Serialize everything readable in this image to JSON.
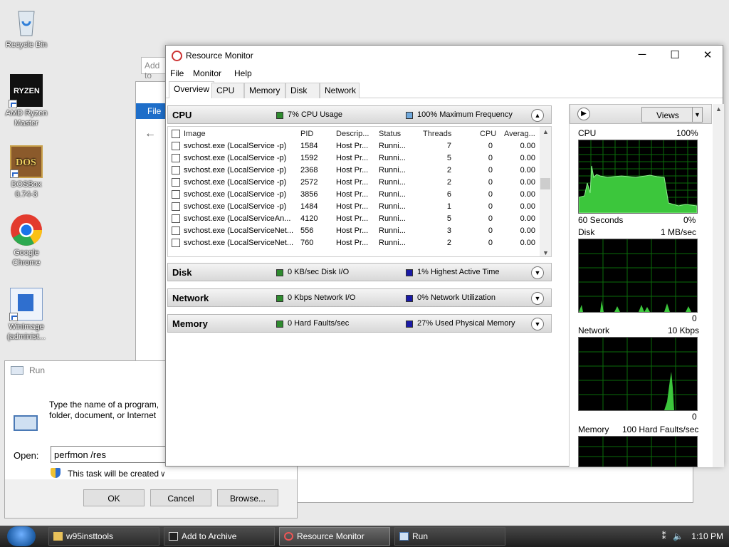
{
  "desktop": {
    "icons": [
      {
        "label": "Recycle Bin"
      },
      {
        "label": "AMD Ryzen Master"
      },
      {
        "label": "DOSBox 0.74-3"
      },
      {
        "label": "Google Chrome"
      },
      {
        "label": "WinImage (administ..."
      }
    ]
  },
  "background": {
    "archive_field": "Add to",
    "explorer_ribbon_file": "File"
  },
  "run_dialog": {
    "title": "Run",
    "description": "Type the name of a program, folder, document, or Internet resource, and Windows will open it for you.",
    "open_label": "Open:",
    "open_value": "perfmon /res",
    "admin_note": "This task will be created with administrative privileges.",
    "ok": "OK",
    "cancel": "Cancel",
    "browse": "Browse..."
  },
  "resource_monitor": {
    "title": "Resource Monitor",
    "menu": [
      "File",
      "Monitor",
      "Help"
    ],
    "tabs": [
      "Overview",
      "CPU",
      "Memory",
      "Disk",
      "Network"
    ],
    "cpu_section": {
      "name": "CPU",
      "stat1": "7% CPU Usage",
      "stat2": "100% Maximum Frequency",
      "columns": [
        "Image",
        "PID",
        "Descrip...",
        "Status",
        "Threads",
        "CPU",
        "Averag..."
      ],
      "rows": [
        [
          "svchost.exe (LocalService -p)",
          "1584",
          "Host Pr...",
          "Runni...",
          "7",
          "0",
          "0.00"
        ],
        [
          "svchost.exe (LocalService -p)",
          "1592",
          "Host Pr...",
          "Runni...",
          "5",
          "0",
          "0.00"
        ],
        [
          "svchost.exe (LocalService -p)",
          "2368",
          "Host Pr...",
          "Runni...",
          "2",
          "0",
          "0.00"
        ],
        [
          "svchost.exe (LocalService -p)",
          "2572",
          "Host Pr...",
          "Runni...",
          "2",
          "0",
          "0.00"
        ],
        [
          "svchost.exe (LocalService -p)",
          "3856",
          "Host Pr...",
          "Runni...",
          "6",
          "0",
          "0.00"
        ],
        [
          "svchost.exe (LocalService -p)",
          "1484",
          "Host Pr...",
          "Runni...",
          "1",
          "0",
          "0.00"
        ],
        [
          "svchost.exe (LocalServiceAn...",
          "4120",
          "Host Pr...",
          "Runni...",
          "5",
          "0",
          "0.00"
        ],
        [
          "svchost.exe (LocalServiceNet...",
          "556",
          "Host Pr...",
          "Runni...",
          "3",
          "0",
          "0.00"
        ],
        [
          "svchost.exe (LocalServiceNet...",
          "760",
          "Host Pr...",
          "Runni...",
          "2",
          "0",
          "0.00"
        ]
      ]
    },
    "disk_section": {
      "name": "Disk",
      "stat1": "0 KB/sec Disk I/O",
      "stat2": "1% Highest Active Time"
    },
    "network_section": {
      "name": "Network",
      "stat1": "0 Kbps Network I/O",
      "stat2": "0% Network Utilization"
    },
    "memory_section": {
      "name": "Memory",
      "stat1": "0 Hard Faults/sec",
      "stat2": "27% Used Physical Memory"
    },
    "graphs": {
      "views_label": "Views",
      "cpu": {
        "label": "CPU",
        "max": "100%",
        "footer_left": "60 Seconds",
        "footer_right": "0%"
      },
      "disk": {
        "label": "Disk",
        "max": "1 MB/sec",
        "footer_right": "0"
      },
      "network": {
        "label": "Network",
        "max": "10 Kbps",
        "footer_right": "0"
      },
      "memory": {
        "label": "Memory",
        "max": "100 Hard Faults/sec"
      }
    }
  },
  "taskbar": {
    "buttons": [
      "w95insttools",
      "Add to Archive",
      "Resource Monitor",
      "Run"
    ],
    "clock": "1:10 PM"
  },
  "colors": {
    "graph_bg": "#000000",
    "graph_grid": "#008000",
    "graph_fill": "#3cc63c",
    "cpu_usage_square": "#2e8b2e",
    "max_freq_square": "#6fa8dc",
    "secondary_square": "#1a1aa6"
  }
}
